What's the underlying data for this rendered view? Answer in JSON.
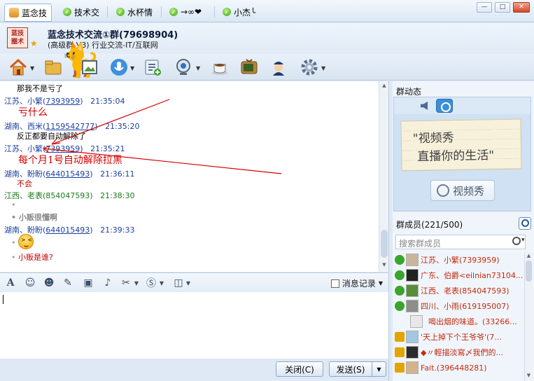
{
  "tabs": [
    {
      "label": "蓝念技",
      "active": true
    },
    {
      "label": "技术交"
    },
    {
      "label": "水杯情"
    },
    {
      "label": "→∞❤"
    },
    {
      "label": "小杰╰"
    }
  ],
  "header": {
    "avatar_text": "蓝技圈术",
    "group_name": "蓝念技术交流①群(79698904)",
    "group_sub": "(高级群 V3) 行业交流-IT/互联网"
  },
  "window_buttons": {
    "min": "—",
    "max": "□",
    "close": "✕"
  },
  "messages": [
    {
      "text": "那我不是亏了"
    },
    {
      "sender": "江苏、小繁",
      "qq": "7393959",
      "time": "21:35:04"
    },
    {
      "sender": "湖南、西米",
      "qq": "1159542777",
      "time": "21:35:20"
    },
    {
      "text": "反正都要自动解除了"
    },
    {
      "sender": "江苏、小繁",
      "qq": "7393959",
      "time": "21:35:21"
    },
    {
      "sender": "湖南、盼盼",
      "qq": "644015493",
      "time": "21:36:11"
    },
    {
      "text": "不会"
    },
    {
      "sender": "江西、老表",
      "qq": "854047593",
      "time": "21:38:30"
    },
    {
      "text": "小贩很懂啊"
    },
    {
      "sender": "湖南、盼盼",
      "qq": "644015493",
      "time": "21:39:33"
    },
    {
      "text": "小贩是谁?"
    }
  ],
  "annotations": {
    "a1": "亏什么",
    "a2": "每个月1号自动解除拉黑"
  },
  "input_toolbar": {
    "history_label": "消息记录"
  },
  "buttons": {
    "close": "关闭(C)",
    "send": "发送(S)"
  },
  "right_panel": {
    "dynamics_title": "群动态",
    "video_line1": "\"视频秀",
    "video_line2": "直播你的生活\"",
    "video_button": "视频秀",
    "members_title": "群成员(221/500)",
    "search_placeholder": "搜索群成员"
  },
  "members": [
    {
      "name": "江苏、小繁(7393959)",
      "role_color": "#3aa52a"
    },
    {
      "name": "广东、伯爵<eilnian73104...",
      "role_color": "#3aa52a"
    },
    {
      "name": "江西、老表(854047593)",
      "role_color": "#3aa52a"
    },
    {
      "name": "四川、小雨(619195007)",
      "role_color": "#3aa52a"
    },
    {
      "name": "喝出烟的味道。(33266...",
      "role_color": ""
    },
    {
      "name": "'天上掉下个王爷爷'(7...",
      "role_color": "#e2a400"
    },
    {
      "name": "◆〃輕描淡寫〆我們的...",
      "role_color": "#e2a400"
    },
    {
      "name": "Fait.(396448281)",
      "role_color": "#e2a400"
    }
  ]
}
